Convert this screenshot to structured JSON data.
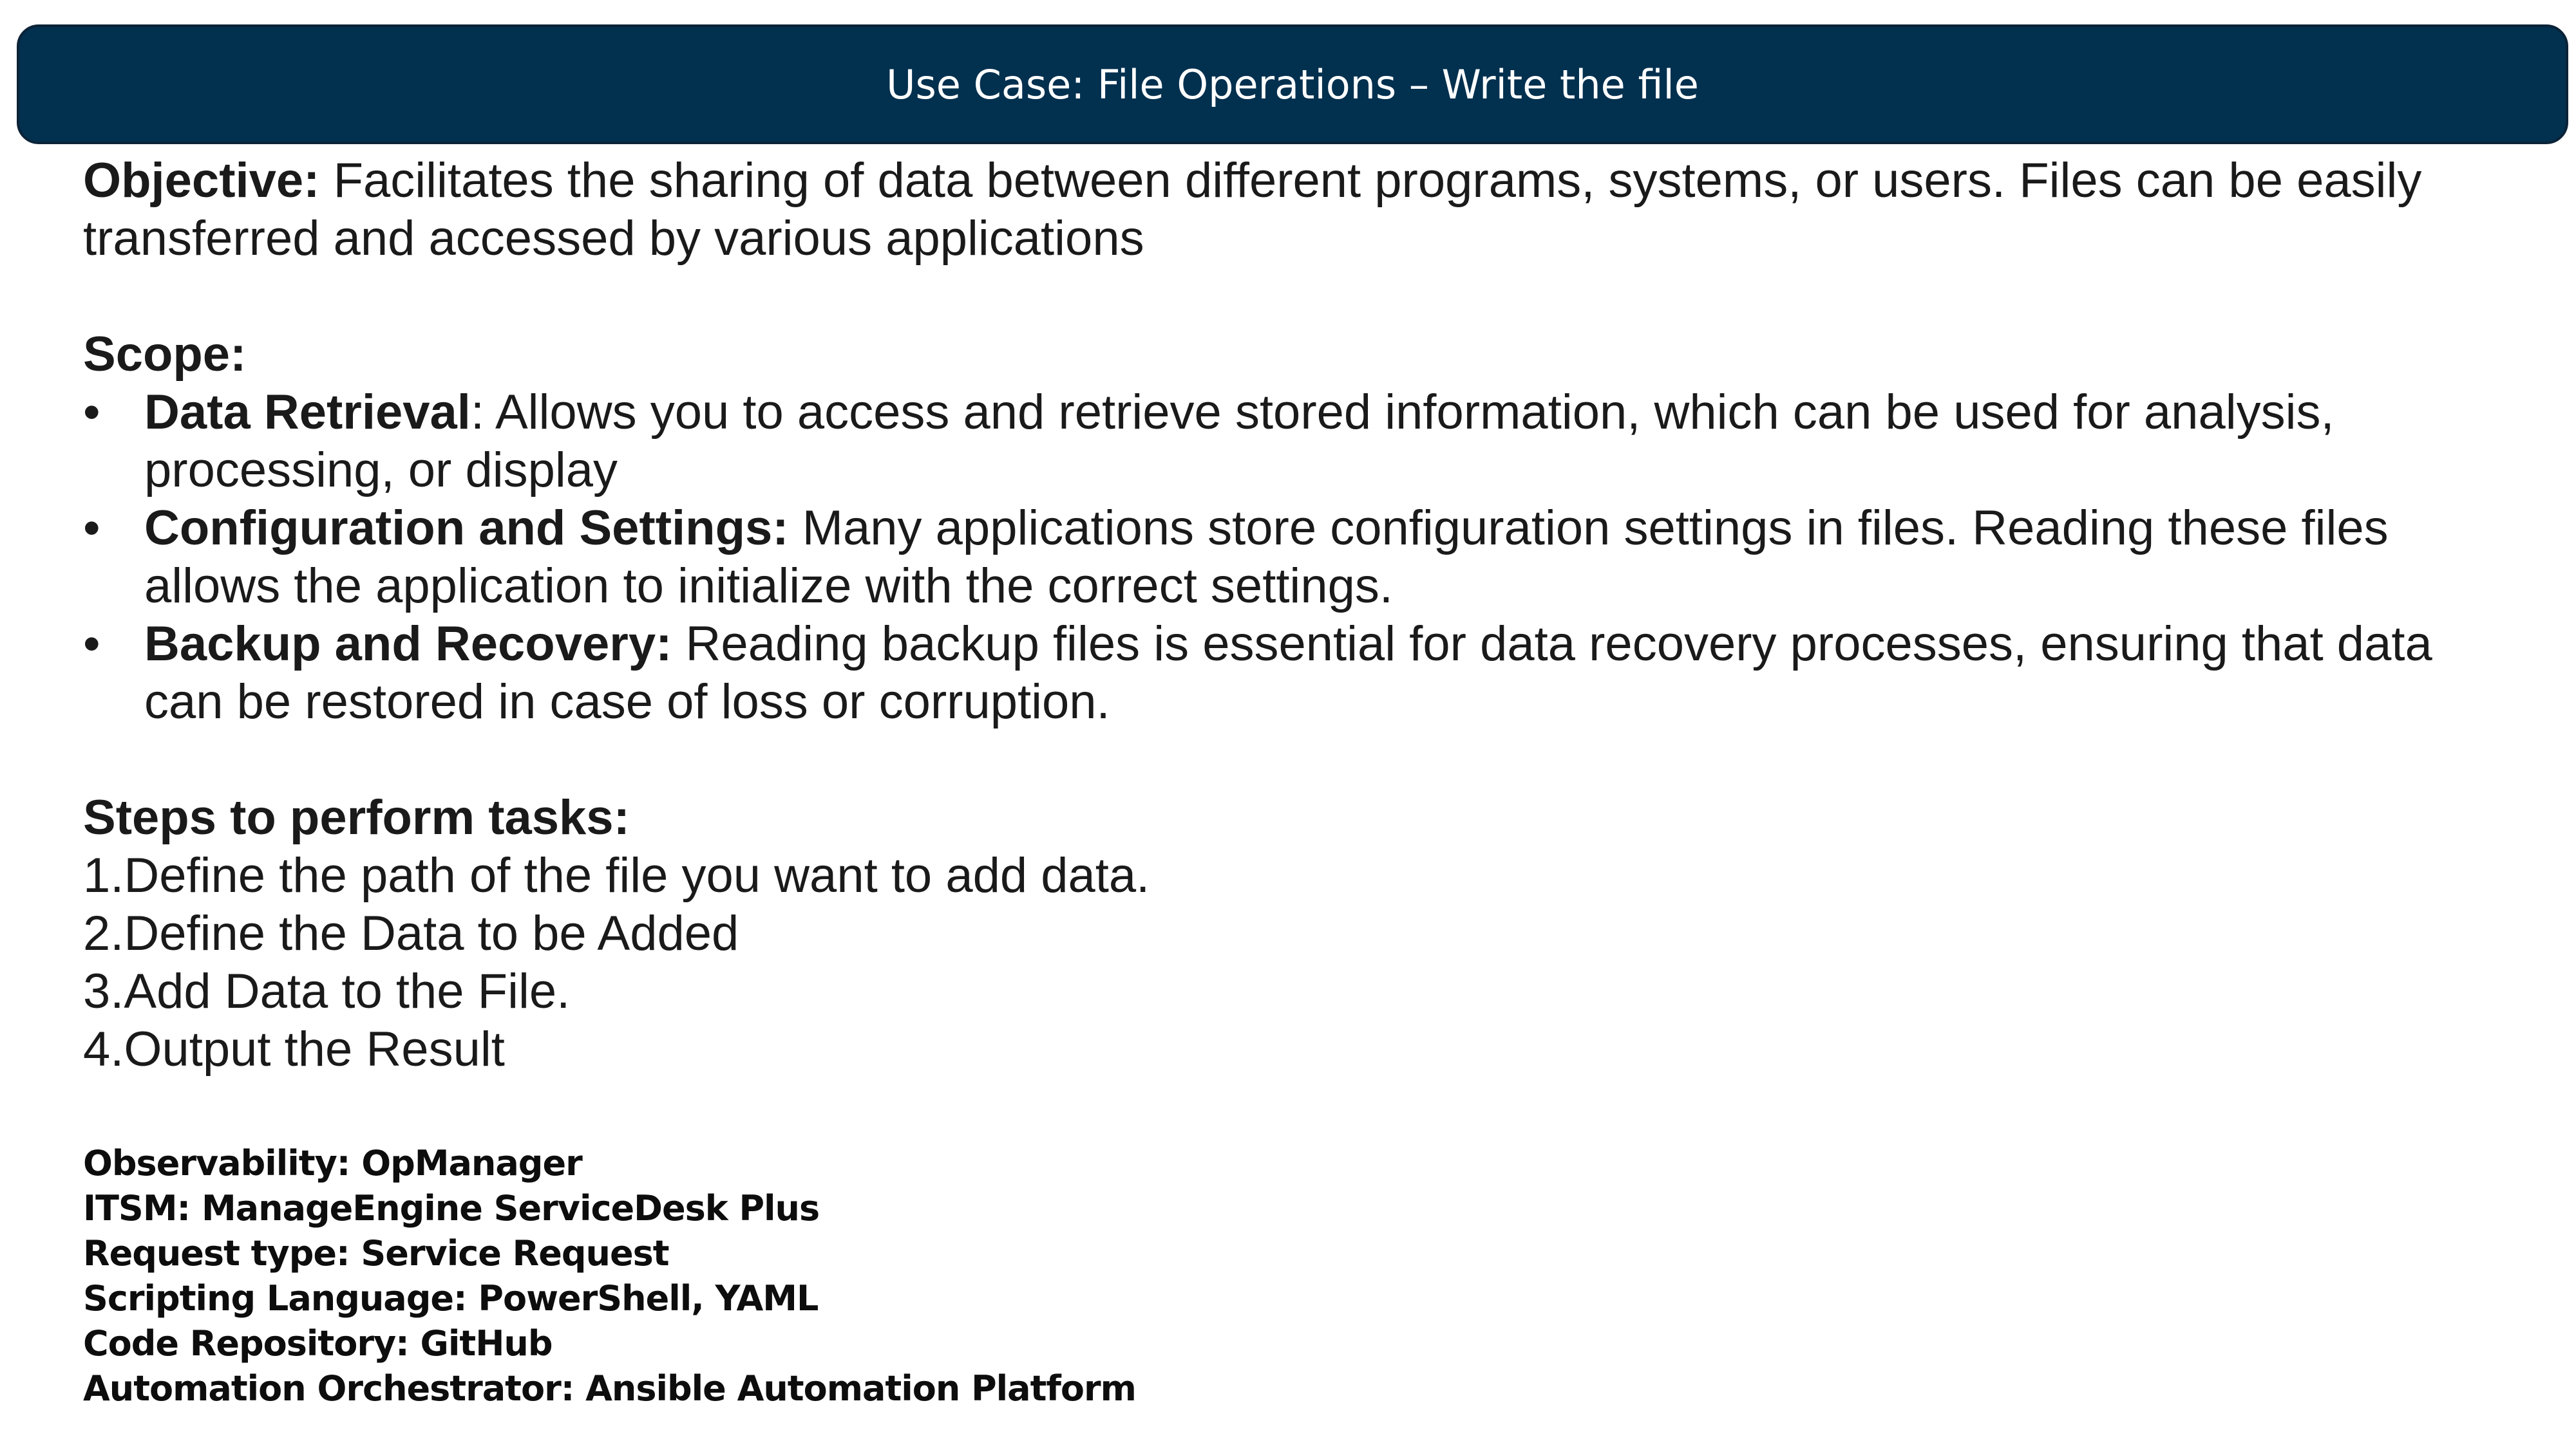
{
  "header": {
    "title": "Use Case: File Operations – Write the file"
  },
  "objective": {
    "label": "Objective:",
    "text": " Facilitates the sharing of data between different programs, systems, or users. Files can be easily transferred and accessed by various applications"
  },
  "scope": {
    "heading": "Scope:",
    "bullet_glyph": "•",
    "items": [
      {
        "label": "Data Retrieval",
        "text": ": Allows you to access and retrieve stored information, which can be used for analysis, processing, or display"
      },
      {
        "label": "Configuration and Settings:",
        "text": " Many applications store configuration settings in files. Reading these files allows the application to initialize with the correct settings."
      },
      {
        "label": "Backup and Recovery:",
        "text": " Reading backup files is essential for data recovery processes, ensuring that data can be restored in case of loss or corruption."
      }
    ]
  },
  "steps": {
    "heading": "Steps to perform tasks:",
    "items": [
      "1.Define the path of the file you want to add data.",
      "2.Define the Data to be Added",
      "3.Add Data to the File.",
      "4.Output the Result"
    ]
  },
  "metadata": {
    "lines": [
      "Observability: OpManager",
      "ITSM: ManageEngine ServiceDesk Plus",
      "Request type: Service Request",
      "Scripting Language: PowerShell, YAML",
      "Code Repository: GitHub",
      "Automation Orchestrator: Ansible Automation Platform"
    ]
  },
  "colors": {
    "header_background": "#02304f",
    "header_text": "#ffffff",
    "body_text": "#1a1a1a"
  }
}
